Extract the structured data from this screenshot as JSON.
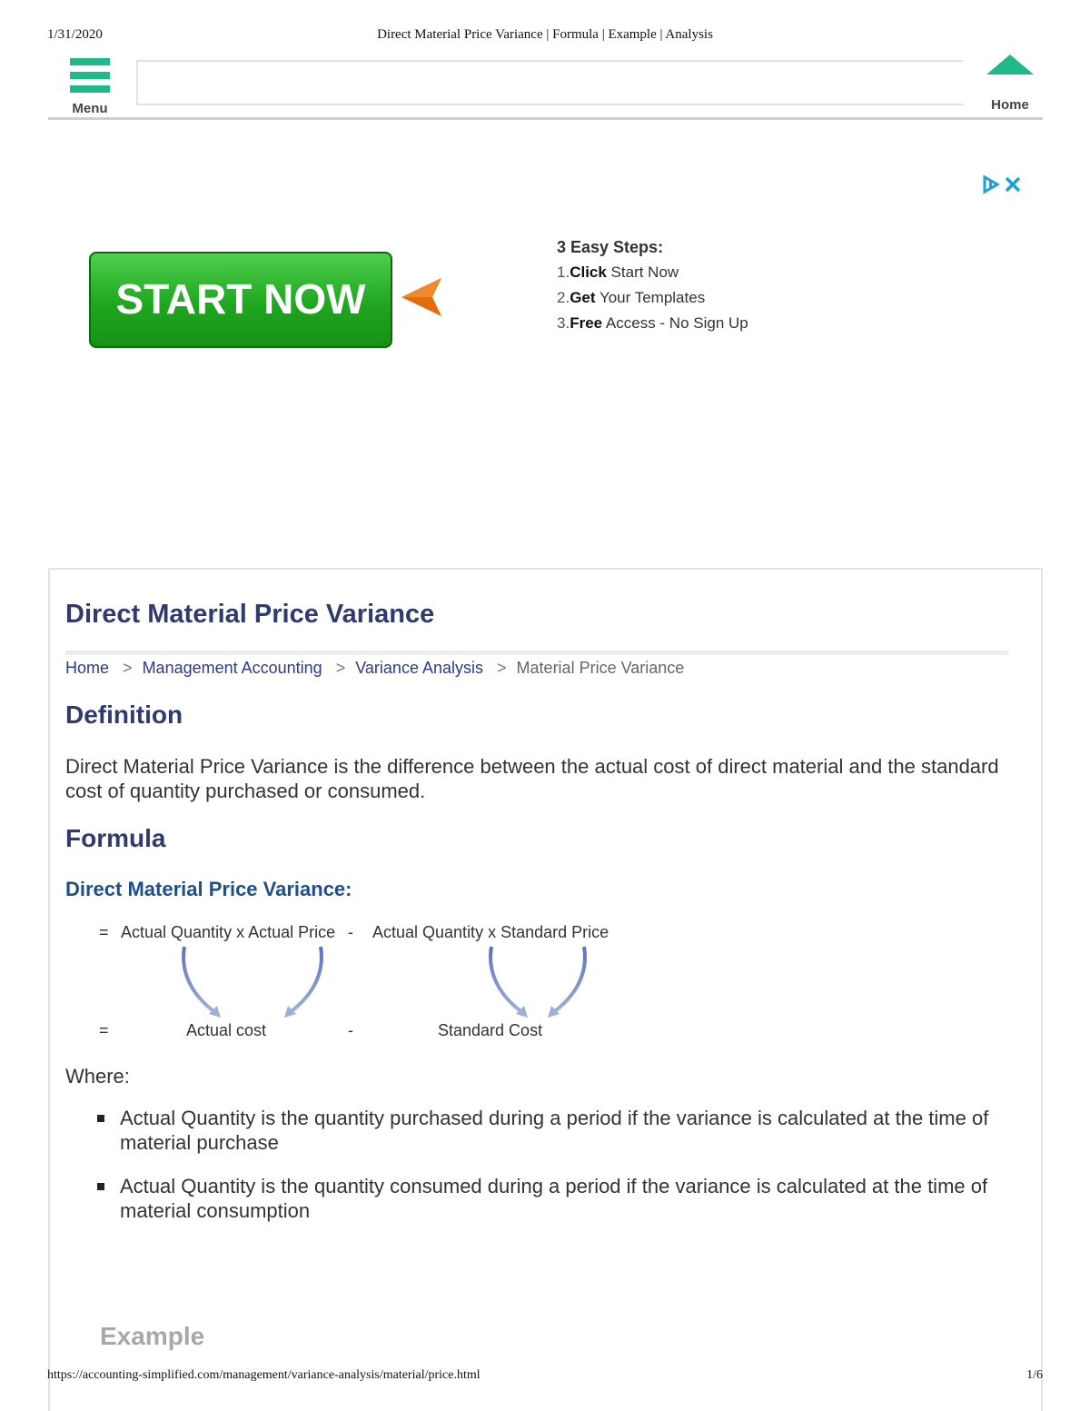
{
  "print_header": {
    "date": "1/31/2020",
    "title": "Direct Material Price Variance | Formula | Example | Analysis"
  },
  "topbar": {
    "menu_label": "Menu",
    "home_label": "Home",
    "search_value": ""
  },
  "ad": {
    "button_label": "START NOW",
    "steps_title": "3 Easy Steps:",
    "steps": [
      {
        "num": "1.",
        "bold": "Click",
        "rest": " Start Now"
      },
      {
        "num": "2.",
        "bold": "Get",
        "rest": " Your Templates"
      },
      {
        "num": "3.",
        "bold": "Free",
        "rest": " Access - No Sign Up"
      }
    ],
    "accent_color": "#1aa3d9"
  },
  "article": {
    "title": "Direct Material Price Variance",
    "breadcrumbs": [
      "Home",
      "Management Accounting",
      "Variance Analysis"
    ],
    "breadcrumb_current": "Material Price Variance",
    "definition_heading": "Definition",
    "definition_text": "Direct Material Price Variance is the difference between the actual cost of direct material and the standard cost of quantity purchased or consumed.",
    "formula_heading": "Formula",
    "formula_subheading": "Direct Material Price Variance:",
    "formula": {
      "eq1": "=",
      "left1": "Actual Quantity x Actual Price",
      "minus1": "-",
      "right1": "Actual Quantity x Standard Price",
      "eq2": "=",
      "left2": "Actual cost",
      "minus2": "-",
      "right2": "Standard Cost"
    },
    "where_label": "Where:",
    "bullets": [
      "Actual Quantity is the quantity purchased during a period if the variance is calculated at the time of material purchase",
      "Actual Quantity is the quantity consumed during a period if the variance is calculated at the time of material consumption"
    ],
    "example_heading": "Example"
  },
  "colors": {
    "brand_green": "#1fb98a",
    "heading_navy": "#2f3a6e",
    "subheading_blue": "#1d4f8c"
  },
  "print_footer": {
    "url": "https://accounting-simplified.com/management/variance-analysis/material/price.html",
    "page": "1/6"
  }
}
